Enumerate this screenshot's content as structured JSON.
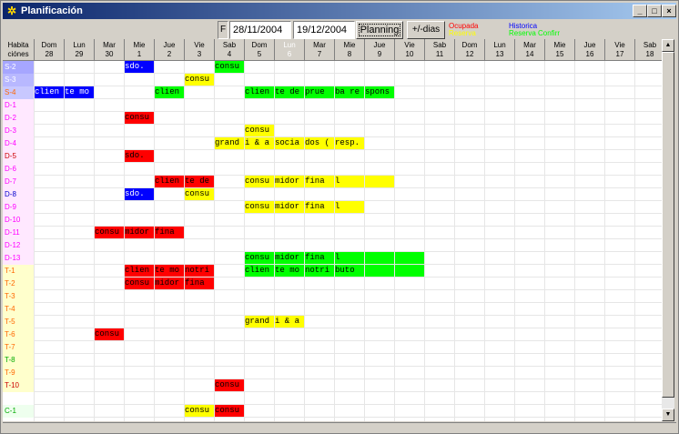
{
  "window": {
    "title": "Planificación",
    "minimize": "_",
    "maximize": "□",
    "close": "×"
  },
  "toolbar": {
    "f_label": "F",
    "date_from": "28/11/2004",
    "date_to": "19/12/2004",
    "planning_label": "Planning",
    "dias_label": "+/-dias"
  },
  "legend": {
    "ocupada": "Ocupada",
    "reserva": "Reserva",
    "historica": "Historica",
    "reserva_confirm": "Reserva Confirr",
    "colors": {
      "ocupada": "#ff0000",
      "reserva": "#ffff00",
      "historica": "#0000ff",
      "reserva_confirm": "#00ff00"
    }
  },
  "header": {
    "corner": [
      "Habita",
      "ciónes"
    ],
    "days": [
      {
        "wd": "Dom",
        "d": "28"
      },
      {
        "wd": "Lun",
        "d": "29"
      },
      {
        "wd": "Mar",
        "d": "30"
      },
      {
        "wd": "Mie",
        "d": "1"
      },
      {
        "wd": "Jue",
        "d": "2"
      },
      {
        "wd": "Vie",
        "d": "3"
      },
      {
        "wd": "Sab",
        "d": "4"
      },
      {
        "wd": "Dom",
        "d": "5"
      },
      {
        "wd": "Lun",
        "d": "6"
      },
      {
        "wd": "Mar",
        "d": "7"
      },
      {
        "wd": "Mie",
        "d": "8"
      },
      {
        "wd": "Jue",
        "d": "9"
      },
      {
        "wd": "Vie",
        "d": "10"
      },
      {
        "wd": "Sab",
        "d": "11"
      },
      {
        "wd": "Dom",
        "d": "12"
      },
      {
        "wd": "Lun",
        "d": "13"
      },
      {
        "wd": "Mar",
        "d": "14"
      },
      {
        "wd": "Mie",
        "d": "15"
      },
      {
        "wd": "Jue",
        "d": "16"
      },
      {
        "wd": "Vie",
        "d": "17"
      },
      {
        "wd": "Sab",
        "d": "18"
      }
    ]
  },
  "rooms": [
    {
      "label": "S-2",
      "color": "#ffffff",
      "bg": "#a6a6ff"
    },
    {
      "label": "S-3",
      "color": "#ffffff",
      "bg": "#b8b8ff"
    },
    {
      "label": "S-4",
      "color": "#ff6600",
      "bg": "#c8c8ff"
    },
    {
      "label": "D-1",
      "color": "#ff00ff",
      "bg": "#ffe8ff"
    },
    {
      "label": "D-2",
      "color": "#ff00ff",
      "bg": "#ffe8ff"
    },
    {
      "label": "D-3",
      "color": "#ff00ff",
      "bg": "#ffe8ff"
    },
    {
      "label": "D-4",
      "color": "#ff00ff",
      "bg": "#ffe8ff"
    },
    {
      "label": "D-5",
      "color": "#cc0000",
      "bg": "#ffe8ff"
    },
    {
      "label": "D-6",
      "color": "#ff00ff",
      "bg": "#ffe8ff"
    },
    {
      "label": "D-7",
      "color": "#ff00ff",
      "bg": "#ffe8ff"
    },
    {
      "label": "D-8",
      "color": "#0000cc",
      "bg": "#ffe8ff"
    },
    {
      "label": "D-9",
      "color": "#ff00ff",
      "bg": "#ffe8ff"
    },
    {
      "label": "D-10",
      "color": "#ff00ff",
      "bg": "#ffe8ff"
    },
    {
      "label": "D-11",
      "color": "#ff00ff",
      "bg": "#ffe8ff"
    },
    {
      "label": "D-12",
      "color": "#ff00ff",
      "bg": "#ffe8ff"
    },
    {
      "label": "D-13",
      "color": "#ff00ff",
      "bg": "#ffe8ff"
    },
    {
      "label": "T-1",
      "color": "#ff6600",
      "bg": "#ffffcc"
    },
    {
      "label": "T-2",
      "color": "#ff6600",
      "bg": "#ffffcc"
    },
    {
      "label": "T-3",
      "color": "#ff6600",
      "bg": "#ffffcc"
    },
    {
      "label": "T-4",
      "color": "#ff6600",
      "bg": "#ffffcc"
    },
    {
      "label": "T-5",
      "color": "#ff6600",
      "bg": "#ffffcc"
    },
    {
      "label": "T-6",
      "color": "#ff6600",
      "bg": "#ffffcc"
    },
    {
      "label": "T-7",
      "color": "#ff6600",
      "bg": "#ffffcc"
    },
    {
      "label": "T-8",
      "color": "#00aa00",
      "bg": "#ffffcc"
    },
    {
      "label": "T-9",
      "color": "#ff6600",
      "bg": "#ffffcc"
    },
    {
      "label": "T-10",
      "color": "#cc0000",
      "bg": "#ffffcc"
    },
    {
      "label": "",
      "color": "#000000",
      "bg": "#ffffff"
    },
    {
      "label": "C-1",
      "color": "#00aa00",
      "bg": "#eeffee"
    }
  ],
  "bookings": [
    {
      "row": 0,
      "col": 3,
      "cells": [
        "sdo."
      ],
      "type": "historica"
    },
    {
      "row": 0,
      "col": 6,
      "cells": [
        "consu"
      ],
      "type": "reserva_confirm"
    },
    {
      "row": 1,
      "col": 5,
      "cells": [
        "consu"
      ],
      "type": "reserva"
    },
    {
      "row": 2,
      "col": 0,
      "cells": [
        "clien",
        "te mo"
      ],
      "type": "historica"
    },
    {
      "row": 2,
      "col": 4,
      "cells": [
        "clien"
      ],
      "type": "reserva_confirm"
    },
    {
      "row": 2,
      "col": 7,
      "cells": [
        "clien",
        "te de",
        "prue",
        "ba re",
        "spons"
      ],
      "type": "reserva_confirm"
    },
    {
      "row": 4,
      "col": 3,
      "cells": [
        "consu"
      ],
      "type": "ocupada"
    },
    {
      "row": 5,
      "col": 7,
      "cells": [
        "consu"
      ],
      "type": "reserva"
    },
    {
      "row": 6,
      "col": 6,
      "cells": [
        "grand",
        "i & a",
        "socia",
        "dos (",
        "resp."
      ],
      "type": "reserva"
    },
    {
      "row": 7,
      "col": 3,
      "cells": [
        "sdo."
      ],
      "type": "ocupada"
    },
    {
      "row": 9,
      "col": 4,
      "cells": [
        "clien",
        "te de"
      ],
      "type": "ocupada"
    },
    {
      "row": 9,
      "col": 7,
      "cells": [
        "consu",
        "midor",
        "fina",
        "l",
        ""
      ],
      "type": "reserva"
    },
    {
      "row": 10,
      "col": 3,
      "cells": [
        "sdo."
      ],
      "type": "historica"
    },
    {
      "row": 10,
      "col": 5,
      "cells": [
        "consu"
      ],
      "type": "reserva"
    },
    {
      "row": 11,
      "col": 7,
      "cells": [
        "consu",
        "midor",
        "fina",
        "l"
      ],
      "type": "reserva"
    },
    {
      "row": 13,
      "col": 2,
      "cells": [
        "consu",
        "midor",
        "fina"
      ],
      "type": "ocupada"
    },
    {
      "row": 15,
      "col": 7,
      "cells": [
        "consu",
        "midor",
        "fina",
        "l",
        "",
        ""
      ],
      "type": "reserva_confirm"
    },
    {
      "row": 16,
      "col": 3,
      "cells": [
        "clien",
        "te mo",
        "notri"
      ],
      "type": "ocupada"
    },
    {
      "row": 16,
      "col": 7,
      "cells": [
        "clien",
        "te mo",
        "notri",
        "buto",
        "",
        ""
      ],
      "type": "reserva_confirm"
    },
    {
      "row": 17,
      "col": 3,
      "cells": [
        "consu",
        "midor",
        "fina"
      ],
      "type": "ocupada"
    },
    {
      "row": 20,
      "col": 7,
      "cells": [
        "grand",
        "i & a"
      ],
      "type": "reserva"
    },
    {
      "row": 21,
      "col": 2,
      "cells": [
        "consu"
      ],
      "type": "ocupada"
    },
    {
      "row": 25,
      "col": 6,
      "cells": [
        "consu"
      ],
      "type": "ocupada"
    },
    {
      "row": 27,
      "col": 5,
      "cells": [
        "consu"
      ],
      "type": "reserva"
    },
    {
      "row": 27,
      "col": 6,
      "cells": [
        "consu"
      ],
      "type": "ocupada"
    }
  ],
  "scrollbar": {
    "up": "▲",
    "down": "▼"
  },
  "status": ""
}
